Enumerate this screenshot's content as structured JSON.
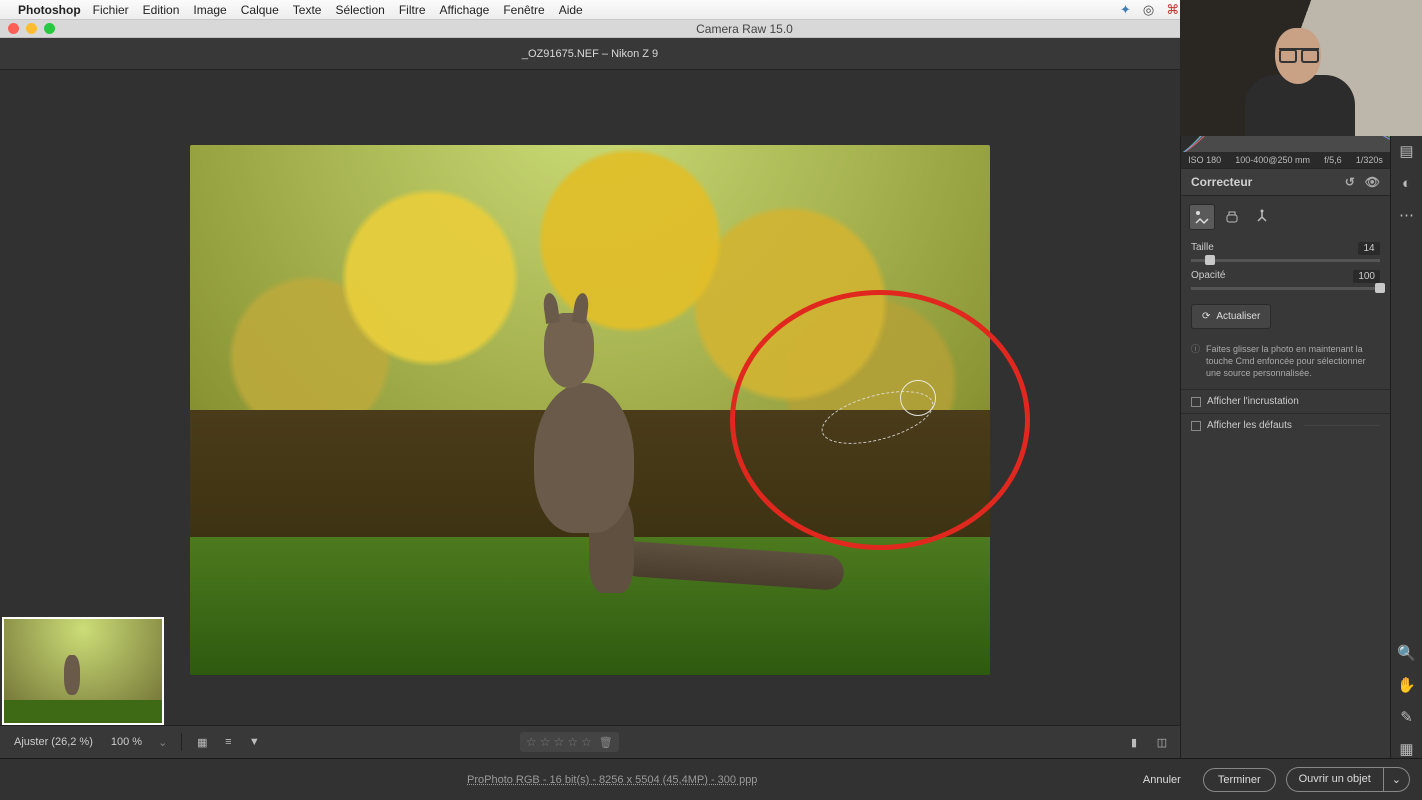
{
  "menubar": {
    "app_name": "Photoshop",
    "items": [
      "Fichier",
      "Edition",
      "Image",
      "Calque",
      "Texte",
      "Sélection",
      "Filtre",
      "Affichage",
      "Fenêtre",
      "Aide"
    ]
  },
  "window": {
    "title": "Camera Raw 15.0",
    "file_label": "_OZ91675.NEF  –  Nikon Z 9"
  },
  "histo": {
    "iso": "ISO 180",
    "lens": "100-400@250 mm",
    "aperture": "f/5,6",
    "shutter": "1/320s"
  },
  "panel": {
    "title": "Correcteur",
    "tool_healing": "healing-brush",
    "tool_clone": "clone-stamp",
    "tool_remove": "remove",
    "size_label": "Taille",
    "size_value": "14",
    "size_pct": 10,
    "opacity_label": "Opacité",
    "opacity_value": "100",
    "opacity_pct": 100,
    "refresh_label": "Actualiser",
    "hint_text": "Faites glisser la photo en maintenant la touche Cmd enfoncée pour sélectionner une source personnalisée.",
    "checkbox_overlay": "Afficher l'incrustation",
    "checkbox_defects": "Afficher les défauts"
  },
  "toolbar": {
    "fit_label": "Ajuster (26,2 %)",
    "zoom100": "100 %"
  },
  "status": {
    "info_link": "ProPhoto RGB - 16 bit(s) - 8256 x 5504 (45,4MP) - 300 ppp",
    "cancel": "Annuler",
    "done": "Terminer",
    "open": "Ouvrir un objet"
  }
}
